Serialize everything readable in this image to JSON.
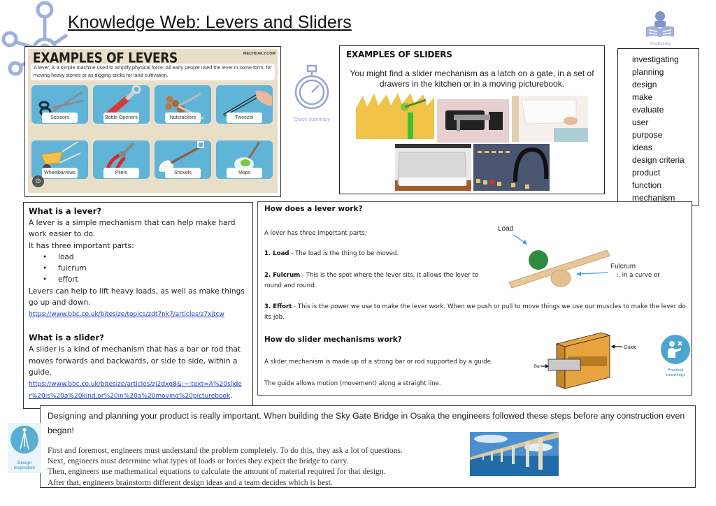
{
  "title": "Knowledge Web: Levers and Sliders",
  "icons": {
    "knowledge_web": "knowledge-web-icon",
    "quick_summary": {
      "icon": "stopwatch-icon",
      "label": "Quick summary"
    },
    "vocabulary": {
      "icon": "reading-book-icon",
      "label": "Vocabulary"
    },
    "practical_knowledge": {
      "icon": "person-teaching-icon",
      "label_line1": "Practical",
      "label_line2": "knowledge"
    },
    "design_inspiration": {
      "icon": "compass-icon",
      "label_line1": "Design",
      "label_line2": "inspiration"
    }
  },
  "lever_examples": {
    "heading": "EXAMPLES OF LEVERS",
    "brand": "MECHDAILY.COM",
    "description": "A lever, is a simple machine used to amplify physical force. All early people used the lever in some form, for moving heavy stones or as digging sticks for land cultivation.",
    "tiles": [
      {
        "label": "Scissors"
      },
      {
        "label": "Bottle Openers"
      },
      {
        "label": "Nutcrackers"
      },
      {
        "label": "Tweezer"
      },
      {
        "label": "Wheelbarrows"
      },
      {
        "label": "Pliers"
      },
      {
        "label": "Shovels"
      },
      {
        "label": "Mops"
      }
    ]
  },
  "slider_examples": {
    "heading": "EXAMPLES OF SLIDERS",
    "description": "You might find a slider mechanism as a latch on a gate, in a set of drawers in the kitchen or in a moving picturebook.",
    "photos": [
      "picturebook-slider",
      "door-bolt-latch",
      "storage-drawer",
      "kitchen-drawer",
      "mixing-desk-faders"
    ]
  },
  "vocabulary": [
    "investigating",
    "planning",
    "design",
    "make",
    "evaluate",
    "user",
    "purpose",
    "ideas",
    "design criteria",
    "product",
    "function",
    "mechanism"
  ],
  "what_is_lever": {
    "heading": "What is a lever?",
    "text1": "A lever is a simple mechanism that can help make hard work easier to do.",
    "text2": "It has three important parts:",
    "parts": [
      "load",
      "fulcrum",
      "effort"
    ],
    "text3": "Levers can help to lift heavy loads, as well as make things go up and down.",
    "link": "https://www.bbc.co.uk/bitesize/topics/zdt7nk7/articles/z7xjtcw"
  },
  "what_is_slider": {
    "heading": "What is a slider?",
    "text": "A slider is a kind of mechanism that has a bar or rod that moves forwards and backwards, or side to side, within a guide.",
    "link": "https://www.bbc.co.uk/bitesize/articles/zj2dxg8&:~:text=A%20slider%20is%20a%20kind,or%20in%20a%20moving%20picturebook",
    "link_suffix": "."
  },
  "how_lever": {
    "heading": "How does a lever work?",
    "intro": "A lever has three important parts:",
    "load_term": "1. Load",
    "load_text": " - The load is the thing to be moved.",
    "fulcrum_term": "2. Fulcrum",
    "fulcrum_text_a": " - This is the spot where the lever sits. It allows the lever to",
    "fulcrum_text_b": "ide, in a curve or",
    "fulcrum_text_c": "round and round.",
    "effort_term": "3. Effort",
    "effort_text": " - This is the power we use to make the lever work. When we push or pull to move things we use our muscles to make the lever do its job.",
    "diagram_load": "Load",
    "diagram_fulcrum": "Fulcrum"
  },
  "how_slider": {
    "heading": "How do slider mechanisms work?",
    "text1": "A slider mechanism is made up of a strong bar or rod supported by a guide.",
    "text2": "The guide allows motion (movement) along a straight line.",
    "diagram_guide": "Guide",
    "diagram_bar": "Bar"
  },
  "design": {
    "lead": "Designing and planning your product is really important. When building the Sky Gate Bridge in Osaka the engineers followed these steps before any construction even began!",
    "steps": [
      "First and foremost, engineers must understand the problem completely. To do this, they ask a lot of questions.",
      "Next, engineers must determine what types of loads or forces they expect the bridge to carry.",
      "Then, engineers use mathematical equations to calculate the amount of material required for that design.",
      "After that, engineers brainstorm different design ideas and a team decides which is best."
    ],
    "photo": "sky-gate-bridge-photo"
  }
}
